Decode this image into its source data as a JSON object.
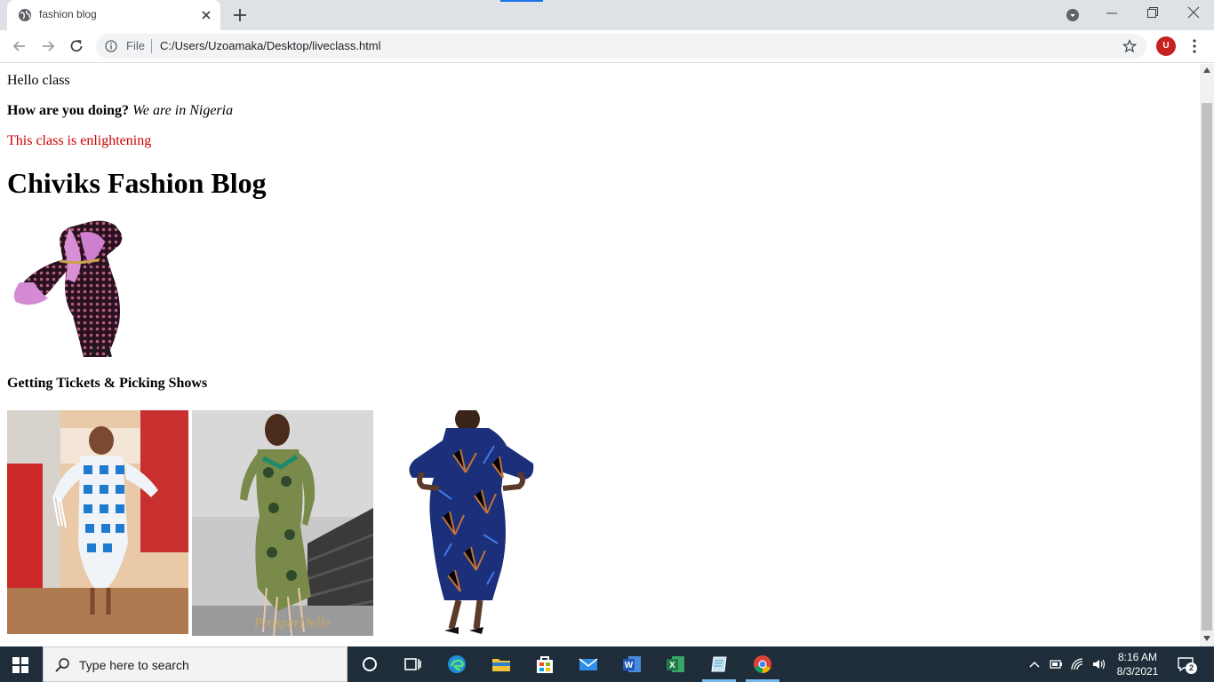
{
  "browser": {
    "tab_title": "fashion blog",
    "scheme_label": "File",
    "url": "C:/Users/Uzoamaka/Desktop/liveclass.html",
    "profile_initial": "U",
    "accent_color": "#1a73e8",
    "profile_color": "#c5221f"
  },
  "page": {
    "line1": "Hello class",
    "line2_bold": "How are you doing?",
    "line2_italic": "We are in Nigeria",
    "line3": "This class is enlightening",
    "line3_color": "#cc0000",
    "heading": "Chiviks Fashion Blog",
    "subheading": "Getting Tickets & Picking Shows",
    "images": [
      {
        "name": "pink-lace-dress-image"
      },
      {
        "name": "blue-checked-fringe-dress-image"
      },
      {
        "name": "green-print-fringe-dress-image"
      },
      {
        "name": "blue-ankara-dress-image"
      }
    ]
  },
  "taskbar": {
    "search_placeholder": "Type here to search",
    "time": "8:16 AM",
    "date": "8/3/2021",
    "notification_count": "2",
    "apps": [
      "cortana-icon",
      "task-view-icon",
      "edge-icon",
      "file-explorer-icon",
      "store-icon",
      "mail-icon",
      "word-icon",
      "excel-icon",
      "notepad-icon",
      "chrome-icon"
    ]
  }
}
